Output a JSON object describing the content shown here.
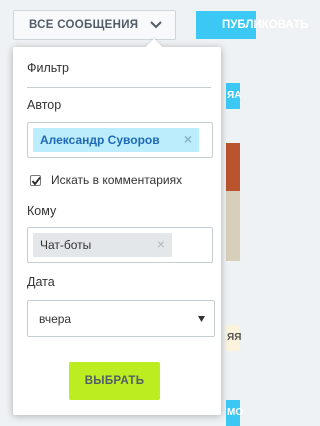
{
  "topbar": {
    "filter_label": "ВСЕ СООБЩЕНИЯ",
    "post_label": "ПУБЛИКОВАТЬ"
  },
  "filter_panel": {
    "title": "Фильтр",
    "author": {
      "label": "Автор",
      "selected": "Александр Суворов",
      "remove_symbol": "×"
    },
    "search_in_comments": {
      "label": "Искать в комментариях",
      "checked": true
    },
    "recipient": {
      "label": "Кому",
      "selected": "Чат-боты",
      "remove_symbol": "×"
    },
    "date": {
      "label": "Дата",
      "value": "вчера"
    },
    "apply_label": "ВЫБРАТЬ"
  },
  "feed_edge": {
    "fragments": [
      "ЯЯ",
      "ЯА",
      "МО"
    ]
  },
  "colors": {
    "accent_blue": "#3bc8f5",
    "apply_green": "#bbed21",
    "author_tag_bg": "#bcedfc",
    "author_tag_text": "#1f6ab5",
    "recipient_tag_bg": "#e4e7ea"
  },
  "icons": {
    "filter_toggle": "chevron-down-icon",
    "remove_tag": "close-icon",
    "checkbox": "checkmark-icon",
    "select": "dropdown-arrow-icon"
  }
}
